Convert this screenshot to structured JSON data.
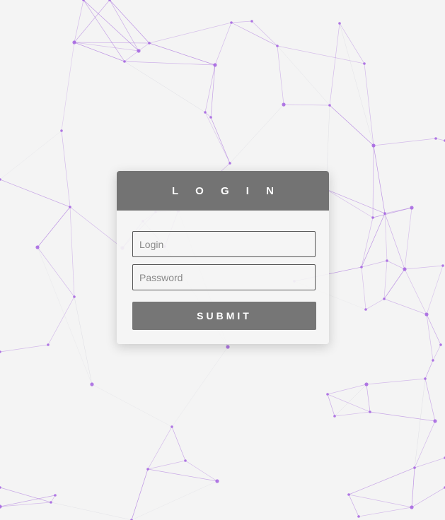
{
  "login": {
    "title": "L O G I N",
    "login_placeholder": "Login",
    "password_placeholder": "Password",
    "submit_label": "SUBMIT"
  },
  "background": {
    "style": "particle-network",
    "line_color": "#9b59d9",
    "node_color": "#a463e0"
  }
}
